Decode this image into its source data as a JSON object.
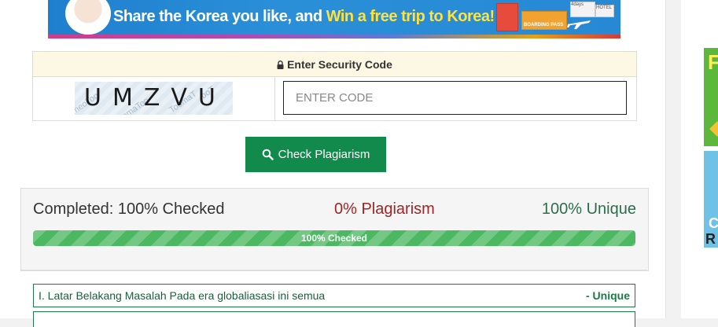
{
  "banner": {
    "text_part1": "Share the Korea you like, and ",
    "text_part2": "Win a free trip to Korea!",
    "ticket_label": "BOARDING PASS",
    "ticket_days": "4days",
    "ticket_hotel": "HOTEL"
  },
  "security": {
    "header_label": "Enter Security Code",
    "captcha_text": "UMZVU",
    "input_placeholder": "ENTER CODE",
    "input_value": ""
  },
  "check_button": {
    "label": "Check Plagiarism"
  },
  "results": {
    "completed_text": "Completed: 100% Checked",
    "plagiarism_text": "0% Plagiarism",
    "unique_text": "100% Unique",
    "progress_label": "100% Checked",
    "progress_value": 1.0
  },
  "sentences": [
    {
      "text": "I. Latar Belakang Masalah Pada era globaliasasi ini semua",
      "tag": "- Unique"
    }
  ],
  "ads": {
    "ad1_letter": "F",
    "ad2_letter1": "C",
    "ad2_letter2": "R"
  },
  "colors": {
    "primary_green": "#118a4b",
    "progress_green": "#4cb962",
    "plagiarism_red": "#a12424",
    "unique_green": "#2d6e4a",
    "header_bg": "#fcf8e3"
  },
  "icons": {
    "lock": "lock-icon",
    "search": "search-icon"
  }
}
